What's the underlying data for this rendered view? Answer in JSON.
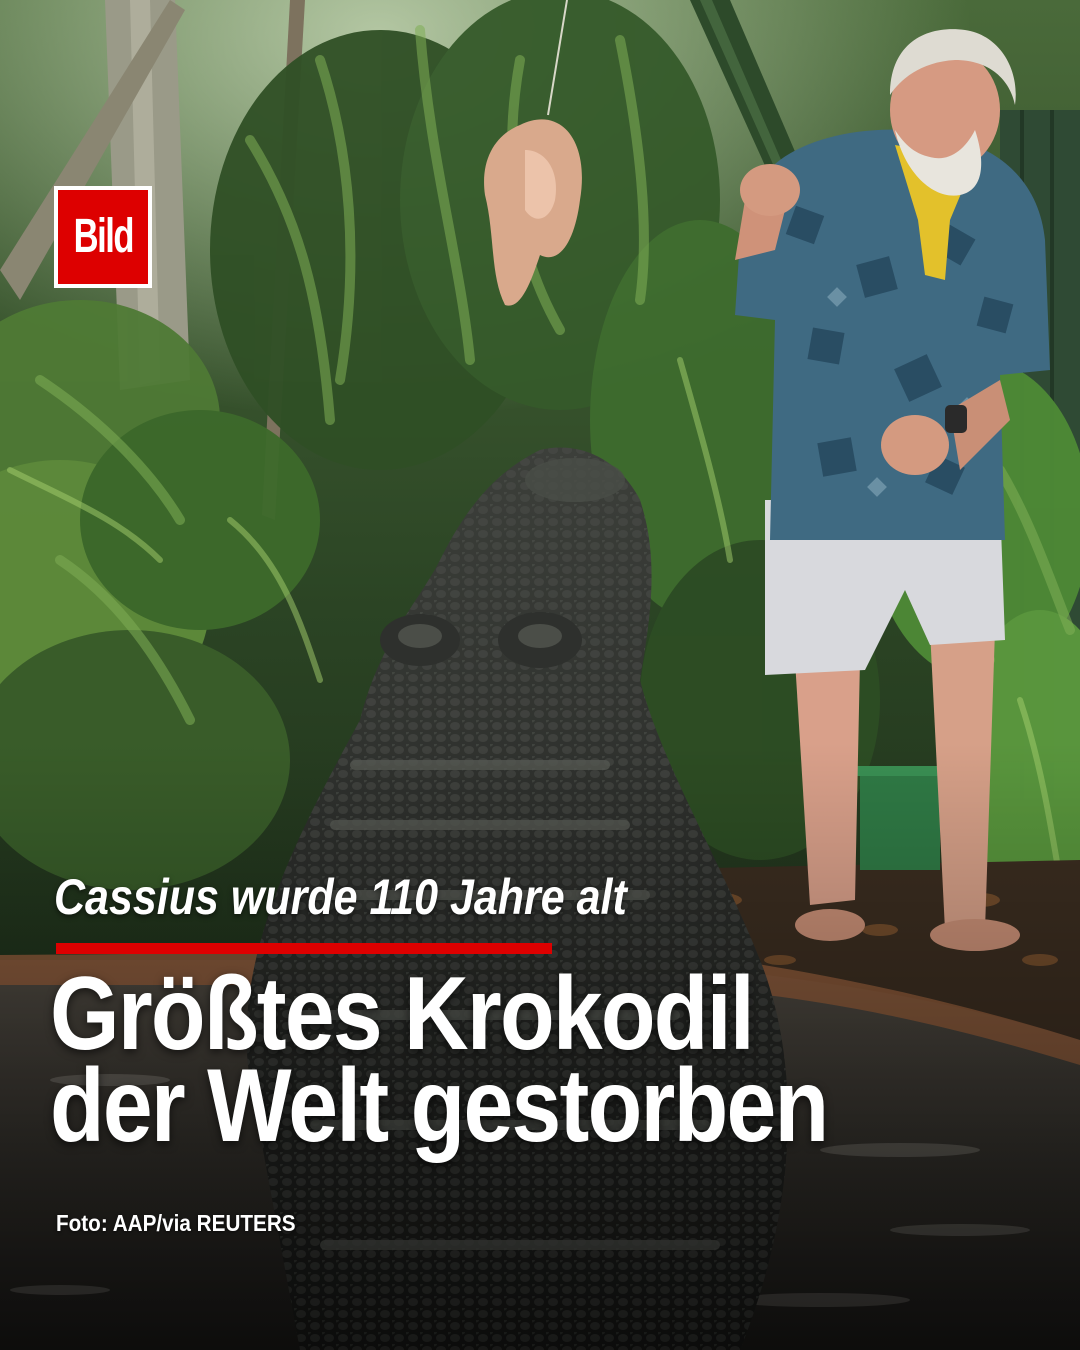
{
  "brand": {
    "logo_text": "Bild",
    "logo_color": "#dd0000"
  },
  "article": {
    "kicker": "Cassius wurde 110 Jahre alt",
    "headline_line1": "Größtes Krokodil",
    "headline_line2": "der Welt gestorben",
    "photo_credit": "Foto: AAP/via REUTERS",
    "accent_color": "#dd0000"
  }
}
